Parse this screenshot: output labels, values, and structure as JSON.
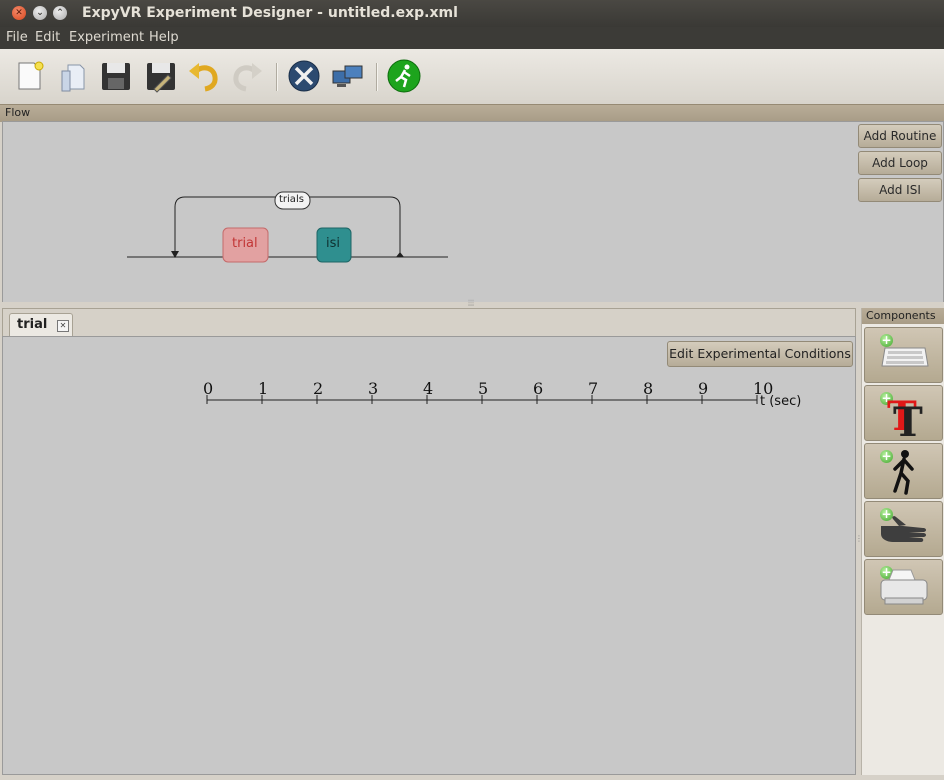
{
  "window": {
    "title": "ExpyVR Experiment Designer - untitled.exp.xml"
  },
  "menu": [
    "File",
    "Edit",
    "Experiment",
    "Help"
  ],
  "toolbar": {
    "icons": [
      "new-file-icon",
      "open-file-icon",
      "save-icon",
      "save-as-icon",
      "undo-icon",
      "redo-icon",
      "preferences-icon",
      "monitor-icon",
      "run-icon"
    ]
  },
  "flow": {
    "header": "Flow",
    "loop_label": "trials",
    "items": [
      {
        "label": "trial",
        "color": "#e2a1a1"
      },
      {
        "label": "isi",
        "color": "#2f8f8f"
      }
    ],
    "buttons": [
      "Add Routine",
      "Add Loop",
      "Add ISI"
    ]
  },
  "routine": {
    "tab_label": "trial",
    "edit_button": "Edit Experimental Conditions",
    "timeline": {
      "ticks": [
        "0",
        "1",
        "2",
        "3",
        "4",
        "5",
        "6",
        "7",
        "8",
        "9",
        "10"
      ],
      "unit_label": "t (sec)",
      "range": [
        0,
        10
      ]
    }
  },
  "components": {
    "header": "Components",
    "items": [
      "keyboard-component-icon",
      "text-component-icon",
      "walking-person-component-icon",
      "hand-component-icon",
      "printer-component-icon"
    ]
  }
}
